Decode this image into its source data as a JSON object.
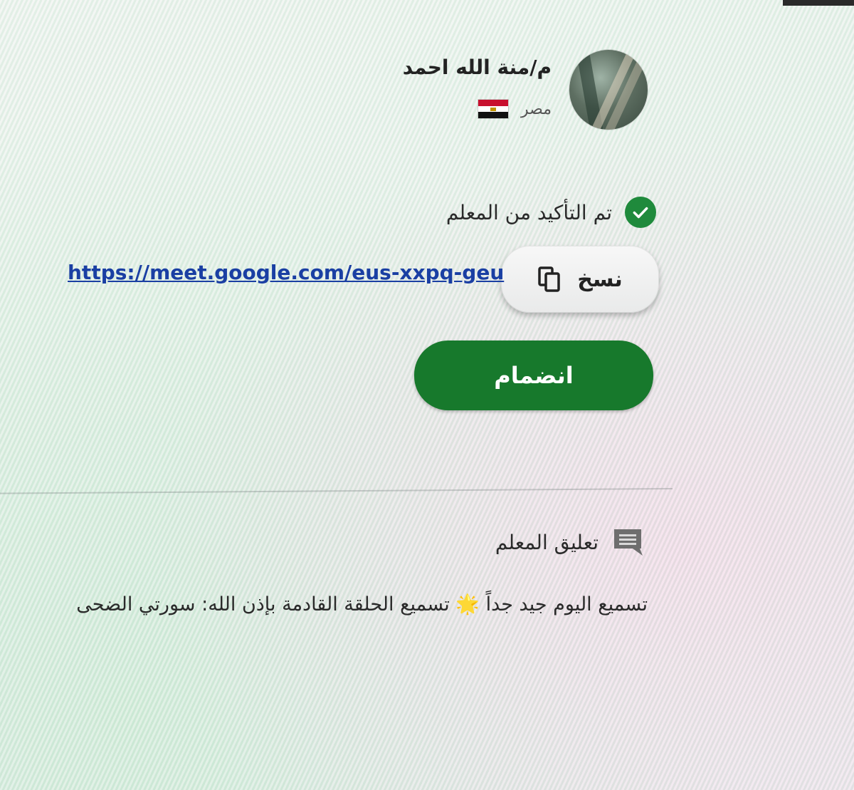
{
  "teacher": {
    "name": "م/منة الله احمد",
    "country": "مصر",
    "flag_icon": "egypt-flag-icon"
  },
  "verification": {
    "text": "تم التأكيد من المعلم",
    "icon": "check-circle-icon",
    "color": "#1f8a3c"
  },
  "meeting": {
    "copy_label": "نسخ",
    "copy_icon": "copy-icon",
    "link": "https://meet.google.com/eus-xxpq-geu",
    "join_label": "انضمام",
    "join_color": "#17792c"
  },
  "comment": {
    "title": "تعليق المعلم",
    "icon": "message-icon",
    "text": "تسميع اليوم جيد جداً 🌟 تسميع الحلقة القادمة بإذن الله: سورتي الضحى"
  }
}
